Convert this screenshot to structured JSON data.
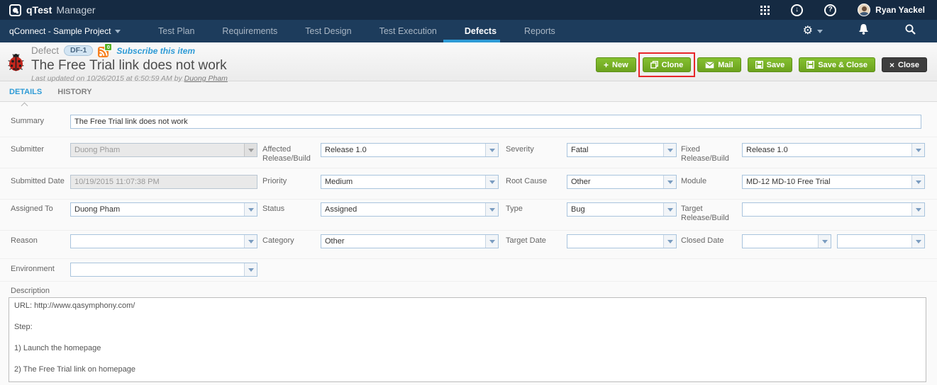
{
  "topbar": {
    "brand": "qTest",
    "product": "Manager",
    "user_name": "Ryan Yackel"
  },
  "navbar": {
    "project_selector": "qConnect - Sample Project",
    "items": [
      {
        "label": "Test Plan",
        "active": false
      },
      {
        "label": "Requirements",
        "active": false
      },
      {
        "label": "Test Design",
        "active": false
      },
      {
        "label": "Test Execution",
        "active": false
      },
      {
        "label": "Defects",
        "active": true
      },
      {
        "label": "Reports",
        "active": false
      }
    ]
  },
  "header": {
    "type_label": "Defect",
    "id_badge": "DF-1",
    "rss_count": "0",
    "subscribe_label": "Subscribe this item",
    "title": "The Free Trial link does not work",
    "last_updated_prefix": "Last updated on 10/26/2015 at 6:50:59 AM by",
    "last_updated_user": "Duong Pham"
  },
  "toolbar": {
    "new_label": "New",
    "new_glyph": "+",
    "clone_label": "Clone",
    "mail_label": "Mail",
    "save_label": "Save",
    "save_close_label": "Save & Close",
    "close_label": "Close",
    "close_glyph": "×"
  },
  "tabs": {
    "details": "DETAILS",
    "history": "HISTORY"
  },
  "form": {
    "summary": {
      "label": "Summary",
      "value": "The Free Trial link does not work"
    },
    "fields": {
      "submitter": {
        "label": "Submitter",
        "value": "Duong Pham",
        "disabled": true
      },
      "affected": {
        "label": "Affected Release/Build",
        "value": "Release 1.0"
      },
      "severity": {
        "label": "Severity",
        "value": "Fatal"
      },
      "fixed": {
        "label": "Fixed Release/Build",
        "value": "Release 1.0"
      },
      "submitted_date": {
        "label": "Submitted Date",
        "value": "10/19/2015 11:07:38 PM",
        "disabled": true
      },
      "priority": {
        "label": "Priority",
        "value": "Medium"
      },
      "root_cause": {
        "label": "Root Cause",
        "value": "Other"
      },
      "module": {
        "label": "Module",
        "value": "MD-12 MD-10 Free Trial"
      },
      "assigned_to": {
        "label": "Assigned To",
        "value": "Duong Pham"
      },
      "status": {
        "label": "Status",
        "value": "Assigned"
      },
      "type": {
        "label": "Type",
        "value": "Bug"
      },
      "target_release": {
        "label": "Target Release/Build",
        "value": ""
      },
      "reason": {
        "label": "Reason",
        "value": ""
      },
      "category": {
        "label": "Category",
        "value": "Other"
      },
      "target_date": {
        "label": "Target Date",
        "value": ""
      },
      "closed_date": {
        "label": "Closed Date",
        "value": "",
        "value2": ""
      },
      "environment": {
        "label": "Environment",
        "value": ""
      }
    },
    "description": {
      "label": "Description",
      "text": "URL: http://www.qasymphony.com/\n\nStep:\n\n1) Launch the homepage\n\n2) The Free Trial link on homepage"
    }
  },
  "icons": {
    "app_grid": "grid",
    "download": "down-arrow-circle",
    "help": "question-circle",
    "settings": "gear",
    "notifications": "bell",
    "search": "magnifier",
    "defect": "ladybug",
    "subscribe": "rss",
    "new": "plus",
    "clone": "copy",
    "mail": "envelope",
    "save": "floppy",
    "close": "x"
  },
  "colors": {
    "top_bar": "#152a42",
    "nav_bar": "#1d3c5c",
    "accent_blue": "#2e9bd6",
    "button_green": "#76b32a",
    "highlight_red": "#e8262a",
    "field_border": "#a9c4dd"
  }
}
